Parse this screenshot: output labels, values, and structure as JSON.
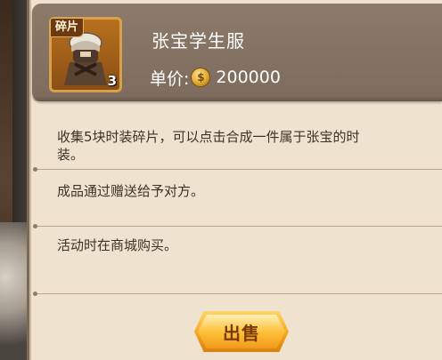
{
  "item": {
    "name": "张宝学生服",
    "fragment_badge": "碎片",
    "count": "3",
    "price_label": "单价:",
    "price_value": "200000",
    "currency_icon": "gold-coin-icon"
  },
  "description": {
    "line1": "收集5块时装碎片，可以点击合成一件属于张宝的时\n装。",
    "line2": "成品通过赠送给予对方。",
    "line3": "活动时在商城购买。"
  },
  "actions": {
    "sell_label": "出售"
  },
  "colors": {
    "panel": "#efe3cf",
    "header": "#8c7a6a",
    "button": "#f5a623",
    "frame": "#d9a04b"
  }
}
